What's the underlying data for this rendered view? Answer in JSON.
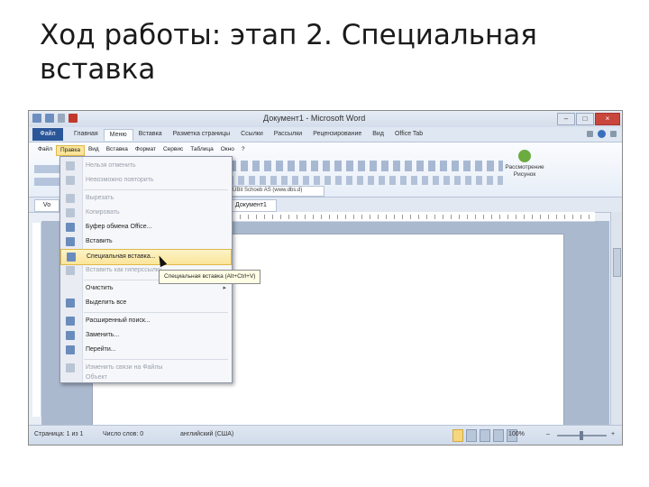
{
  "slide": {
    "title": "Ход работы: этап 2. Специальная вставка"
  },
  "window": {
    "title": "Документ1 - Microsoft Word"
  },
  "window_controls": {
    "minimize": "–",
    "maximize": "□",
    "close": "×"
  },
  "ribbon_tabs": {
    "file": "Файл",
    "items": [
      "Главная",
      "Меню",
      "Вставка",
      "Разметка страницы",
      "Ссылки",
      "Рассылки",
      "Рецензирование",
      "Вид",
      "Office Tab"
    ],
    "active_index": 1
  },
  "menubar": [
    "Файл",
    "Правка",
    "Вид",
    "Вставка",
    "Формат",
    "Сервис",
    "Таблица",
    "Окно",
    "?"
  ],
  "ribbon": {
    "font_preview": "UBit Schoeb AS (www.dbs.d)",
    "compare_group": "Рассмотрение",
    "compare_sub": "Рисунок"
  },
  "doc_tabs": {
    "left": "Vo",
    "active": "Документ1"
  },
  "edit_menu": {
    "items": [
      {
        "label": "Нельзя отменить",
        "disabled": true
      },
      {
        "label": "Невозможно повторить",
        "disabled": true
      },
      {
        "label": "Вырезать",
        "disabled": true
      },
      {
        "label": "Копировать",
        "disabled": true
      },
      {
        "label": "Буфер обмена Office...",
        "disabled": false
      },
      {
        "label": "Вставить",
        "disabled": false
      },
      {
        "label": "Специальная вставка...",
        "disabled": false,
        "highlight": true
      },
      {
        "label": "Вставить как гиперссылку",
        "disabled": true
      },
      {
        "label": "Очистить",
        "disabled": false,
        "submenu": true
      },
      {
        "label": "Выделить все",
        "disabled": false
      },
      {
        "label": "Расширенный поиск...",
        "disabled": false
      },
      {
        "label": "Заменить...",
        "disabled": false
      },
      {
        "label": "Перейти...",
        "disabled": false
      },
      {
        "label": "Изменить связи на Файлы",
        "disabled": true
      },
      {
        "label": "Объект",
        "disabled": true
      }
    ],
    "tooltip": "Специальная вставка (Alt+Ctrl+V)"
  },
  "status_bar": {
    "page": "Страница: 1 из 1",
    "words": "Число слов: 0",
    "language": "английский (США)",
    "zoom": "100%",
    "zoom_minus": "–",
    "zoom_plus": "+"
  },
  "colors": {
    "file_tab": "#2a5699",
    "highlight": "#fbe59a",
    "workspace": "#abb9cf"
  },
  "icons": [
    "word-icon",
    "save-icon",
    "undo-icon",
    "redo-icon",
    "help-icon",
    "cut-icon",
    "copy-icon",
    "paste-icon",
    "find-icon",
    "replace-icon",
    "goto-icon",
    "cursor-icon",
    "compare-icon"
  ]
}
